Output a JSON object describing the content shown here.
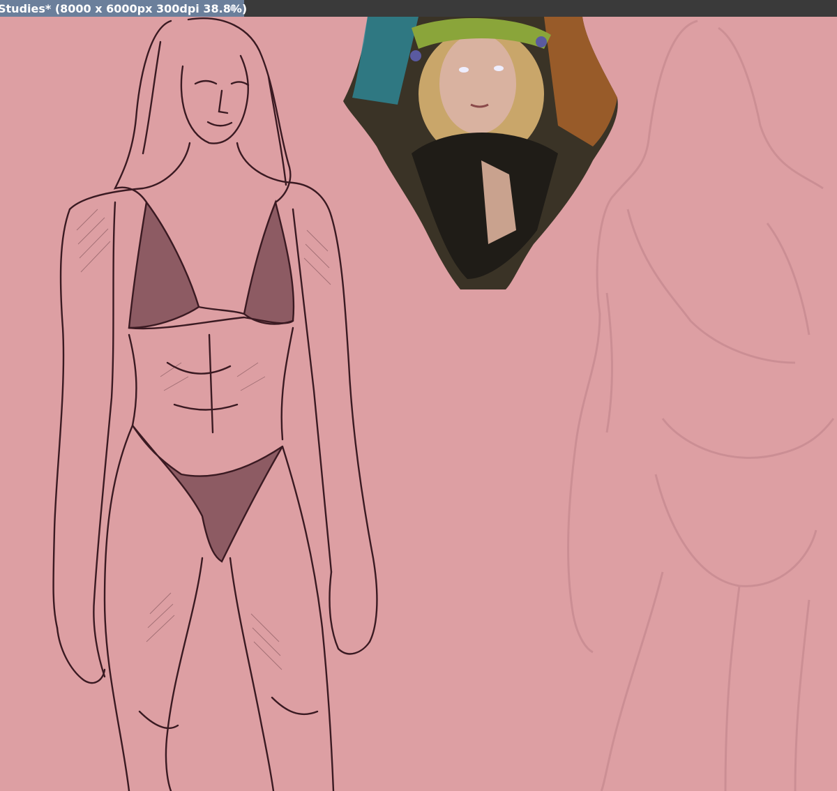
{
  "document_tab": {
    "title": "Studies* (8000 x 6000px 300dpi 38.8%)",
    "modified_indicator_icon": "dot-icon"
  },
  "canvas": {
    "background_color": "#dd9fa3",
    "sketch_line_color": "#3a1a22",
    "faint_sketch_color": "#c98c92"
  }
}
